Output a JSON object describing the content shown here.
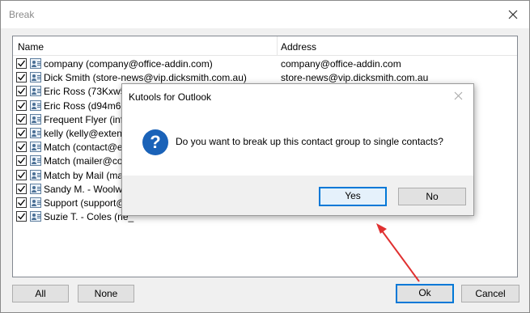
{
  "window": {
    "title": "Break"
  },
  "list": {
    "columns": {
      "name": "Name",
      "address": "Address"
    },
    "rows": [
      {
        "name": "company (company@office-addin.com)",
        "address": "company@office-addin.com",
        "checked": true
      },
      {
        "name": "Dick Smith (store-news@vip.dicksmith.com.au)",
        "address": "store-news@vip.dicksmith.com.au",
        "checked": true
      },
      {
        "name": "Eric Ross (73Kxw547",
        "address": "",
        "checked": true
      },
      {
        "name": "Eric Ross (d94m6l55",
        "address": "",
        "checked": true
      },
      {
        "name": "Frequent Flyer (info",
        "address": "",
        "checked": true
      },
      {
        "name": "kelly (kelly@extendo",
        "address": "",
        "checked": true
      },
      {
        "name": "Match (contact@e.m",
        "address": "",
        "checked": true
      },
      {
        "name": "Match (mailer@conn",
        "address": "",
        "checked": true
      },
      {
        "name": "Match by Mail (match",
        "address": "",
        "checked": true
      },
      {
        "name": "Sandy M. - Woolw. (l",
        "address": "",
        "checked": true
      },
      {
        "name": "Support (support@e",
        "address": "",
        "checked": true
      },
      {
        "name": "Suzie T. - Coles (ne_",
        "address": "",
        "checked": true
      }
    ]
  },
  "buttons": {
    "all": "All",
    "none": "None",
    "ok": "Ok",
    "cancel": "Cancel"
  },
  "dialog": {
    "title": "Kutools for Outlook",
    "message": "Do you want to break up this contact group to single contacts?",
    "yes": "Yes",
    "no": "No",
    "icon": "question-icon"
  },
  "colors": {
    "accent": "#0078d7",
    "annotation_arrow": "#e03030",
    "question_icon": "#1a62b8"
  }
}
